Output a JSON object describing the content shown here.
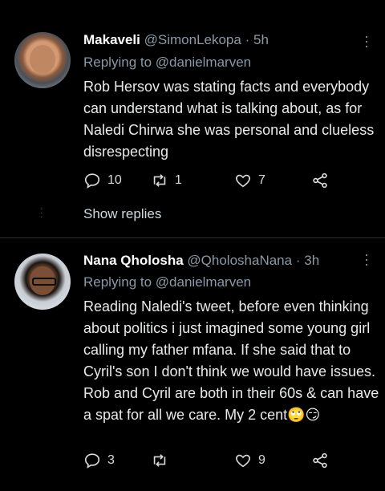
{
  "tweets": [
    {
      "display_name": "Makaveli",
      "handle": "@SimonLekopa",
      "time": "5h",
      "replying_prefix": "Replying to",
      "replying_to": "@danielmarven",
      "body": "Rob Hersov was stating facts and everybody can understand what is talking about, as for Naledi Chirwa she was personal and clueless disrespecting",
      "replies": "10",
      "retweets": "1",
      "likes": "7",
      "show_replies": "Show replies"
    },
    {
      "display_name": "Nana Qholosha",
      "handle": "@QholoshaNana",
      "time": "3h",
      "replying_prefix": "Replying to",
      "replying_to": "@danielmarven",
      "body": "Reading Naledi's tweet, before even thinking about politics i just imagined some young girl calling my father mfana. If she said that to Cyril's son I don't think we would have issues. Rob and Cyril are both in their 60s & can have a spat for all we care. My 2 cent🙄😏",
      "replies": "3",
      "retweets": "",
      "likes": "9"
    }
  ],
  "separator": "·",
  "icons": [
    "reply-icon",
    "retweet-icon",
    "like-icon",
    "share-icon",
    "more-icon"
  ],
  "colors": {
    "background": "#000000",
    "secondary_text": "#8b98a5",
    "icon": "#d9d9d9"
  }
}
